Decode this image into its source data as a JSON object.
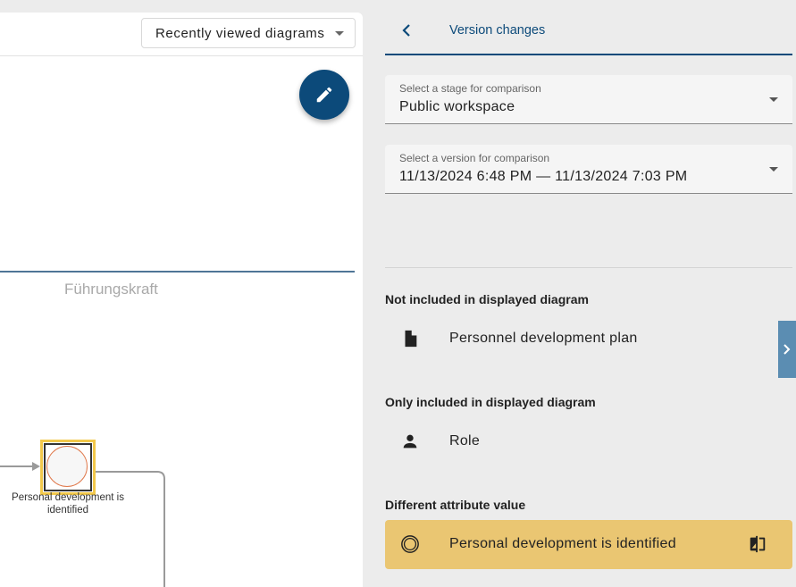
{
  "canvas": {
    "recent_button_label": "Recently viewed diagrams",
    "lane_label": "Führungskraft",
    "event_label": "Personal development is identified",
    "icons": {
      "fab": "pencil-icon"
    }
  },
  "panel": {
    "title": "Version changes",
    "stage_select": {
      "label": "Select a stage for comparison",
      "value": "Public workspace"
    },
    "version_select": {
      "label": "Select a version for comparison",
      "value": "11/13/2024 6:48 PM — 11/13/2024 7:03 PM"
    },
    "sections": [
      {
        "title": "Not included in displayed diagram",
        "item": "Personnel development plan",
        "icon": "document-icon"
      },
      {
        "title": "Only included in displayed diagram",
        "item": "Role",
        "icon": "person-icon"
      },
      {
        "title": "Different attribute value",
        "item": "Personal development is identified",
        "icon": "event-circle-icon"
      }
    ]
  },
  "colors": {
    "accent": "#0c4a7a",
    "highlight": "#eac672",
    "event_border": "#f2c84b",
    "side_tab": "#5b8db2"
  }
}
